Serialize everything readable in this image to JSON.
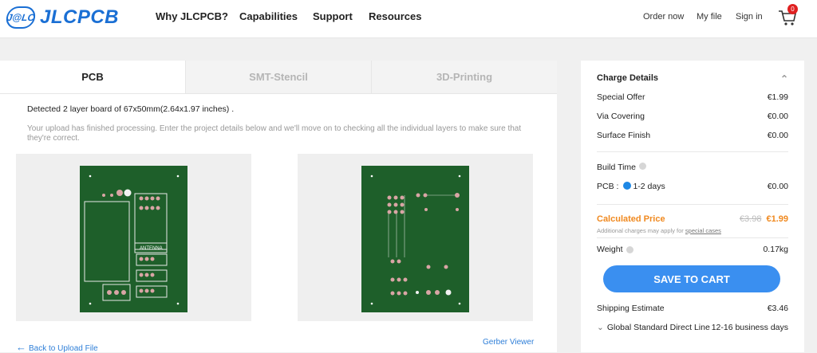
{
  "nav": {
    "logo_mark": "J@LC",
    "logo_text": "JLCPCB",
    "links": [
      "Why JLCPCB?",
      "Capabilities",
      "Support",
      "Resources"
    ],
    "order_now": "Order now",
    "my_file": "My file",
    "sign_in": "Sign in",
    "cart_count": "0"
  },
  "tabs": [
    "PCB",
    "SMT-Stencil",
    "3D-Printing"
  ],
  "main": {
    "detected": "Detected 2 layer board of 67x50mm(2.64x1.97 inches) .",
    "upload_msg": "Your upload has finished processing. Enter the project details below and we'll move on to checking all the individual layers to make sure that they're correct.",
    "back_link": "Back to Upload File",
    "gerber_link": "Gerber Viewer",
    "board_label": "ANTENNA"
  },
  "charge": {
    "title": "Charge Details",
    "special_offer": {
      "label": "Special Offer",
      "value": "€1.99"
    },
    "via_covering": {
      "label": "Via Covering",
      "value": "€0.00"
    },
    "surface_finish": {
      "label": "Surface Finish",
      "value": "€0.00"
    },
    "build_time_label": "Build Time",
    "pcb_label": "PCB :",
    "pcb_option": "1-2 days",
    "pcb_value": "€0.00",
    "calc_label": "Calculated Price",
    "calc_old": "€3.98",
    "calc_new": "€1.99",
    "calc_note": "Additional charges may apply for",
    "calc_note_link": "special cases",
    "weight_label": "Weight",
    "weight_value": "0.17kg",
    "save_button": "SAVE TO CART",
    "shipping_label": "Shipping Estimate",
    "shipping_value": "€3.46",
    "shipping_method": "Global Standard Direct Line",
    "shipping_time": "12-16 business days"
  },
  "colors": {
    "brand_blue": "#1a6fd4",
    "pcb_green": "#1e5f2a",
    "price_orange": "#f0891f",
    "button_blue": "#3a8ff0"
  }
}
